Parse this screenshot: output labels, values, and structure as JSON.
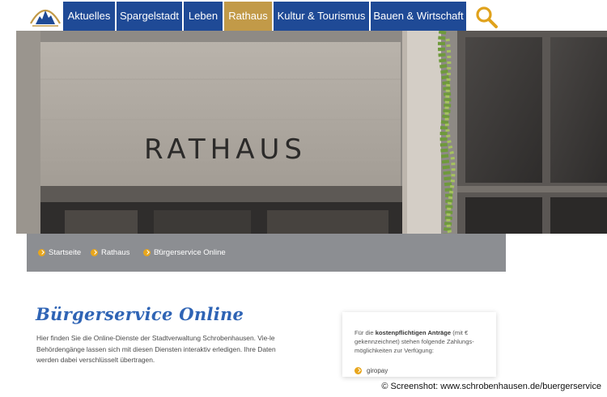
{
  "nav": {
    "items": [
      {
        "label": "Aktuelles",
        "active": false
      },
      {
        "label": "Spargelstadt",
        "active": false
      },
      {
        "label": "Leben",
        "active": false
      },
      {
        "label": "Rathaus",
        "active": true
      },
      {
        "label": "Kultur & Tourismus",
        "active": false
      },
      {
        "label": "Bauen & Wirtschaft",
        "active": false
      }
    ],
    "search_icon": "search-icon",
    "colors": {
      "primary": "#1f4a96",
      "active": "#c29a48",
      "search": "#e0a21c"
    }
  },
  "hero": {
    "sign_text": "RATHAUS"
  },
  "breadcrumb": {
    "items": [
      "Startseite",
      "Rathaus",
      "Bürgerservice Online"
    ],
    "caret": "˅"
  },
  "content": {
    "title": "Bürgerservice Online",
    "intro": "Hier finden Sie die Online-Dienste der Stadtverwaltung Schrobenhausen. Vie-le Behördengänge lassen sich mit diesen Diensten interaktiv erledigen. Ihre Daten werden dabei verschlüsselt übertragen."
  },
  "payment_box": {
    "text_before": "Für die ",
    "text_bold": "kostenpflichtigen Anträge",
    "text_after": " (mit € gekennzeichnet) stehen folgende Zahlungs-möglichkeiten zur Verfügung:",
    "items": [
      "giropay"
    ]
  },
  "credit": "© Screenshot: www.schrobenhausen.de/buergerservice"
}
